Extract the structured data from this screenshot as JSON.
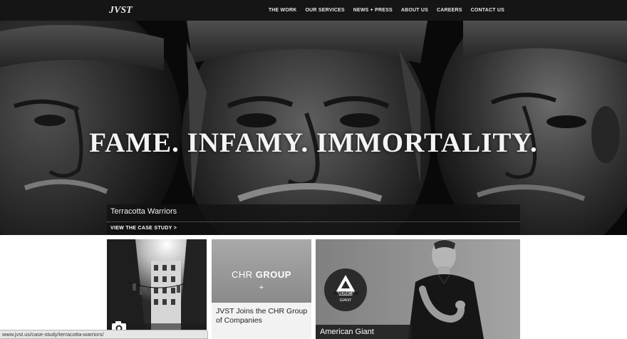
{
  "brand": {
    "logo_text": "JVST"
  },
  "nav": {
    "items": [
      "THE WORK",
      "OUR SERVICES",
      "NEWS + PRESS",
      "ABOUT US",
      "CAREERS",
      "CONTACT US"
    ]
  },
  "hero": {
    "headline": "FAME. INFAMY. IMMORTALITY.",
    "case_title": "Terracotta Warriors",
    "case_link": "VIEW THE CASE STUDY >"
  },
  "tiles": {
    "chr": {
      "logo_light": "CHR ",
      "logo_bold": "GROUP",
      "plus": "+",
      "caption": "JVST Joins the CHR Group of Companies"
    },
    "american_giant": {
      "badge_line1": "AMERICAN",
      "badge_line2": "GIANT",
      "caption": "American Giant"
    }
  },
  "status_bar": {
    "url": "www.jvst.us/case-study/terracotta-warriors/"
  }
}
